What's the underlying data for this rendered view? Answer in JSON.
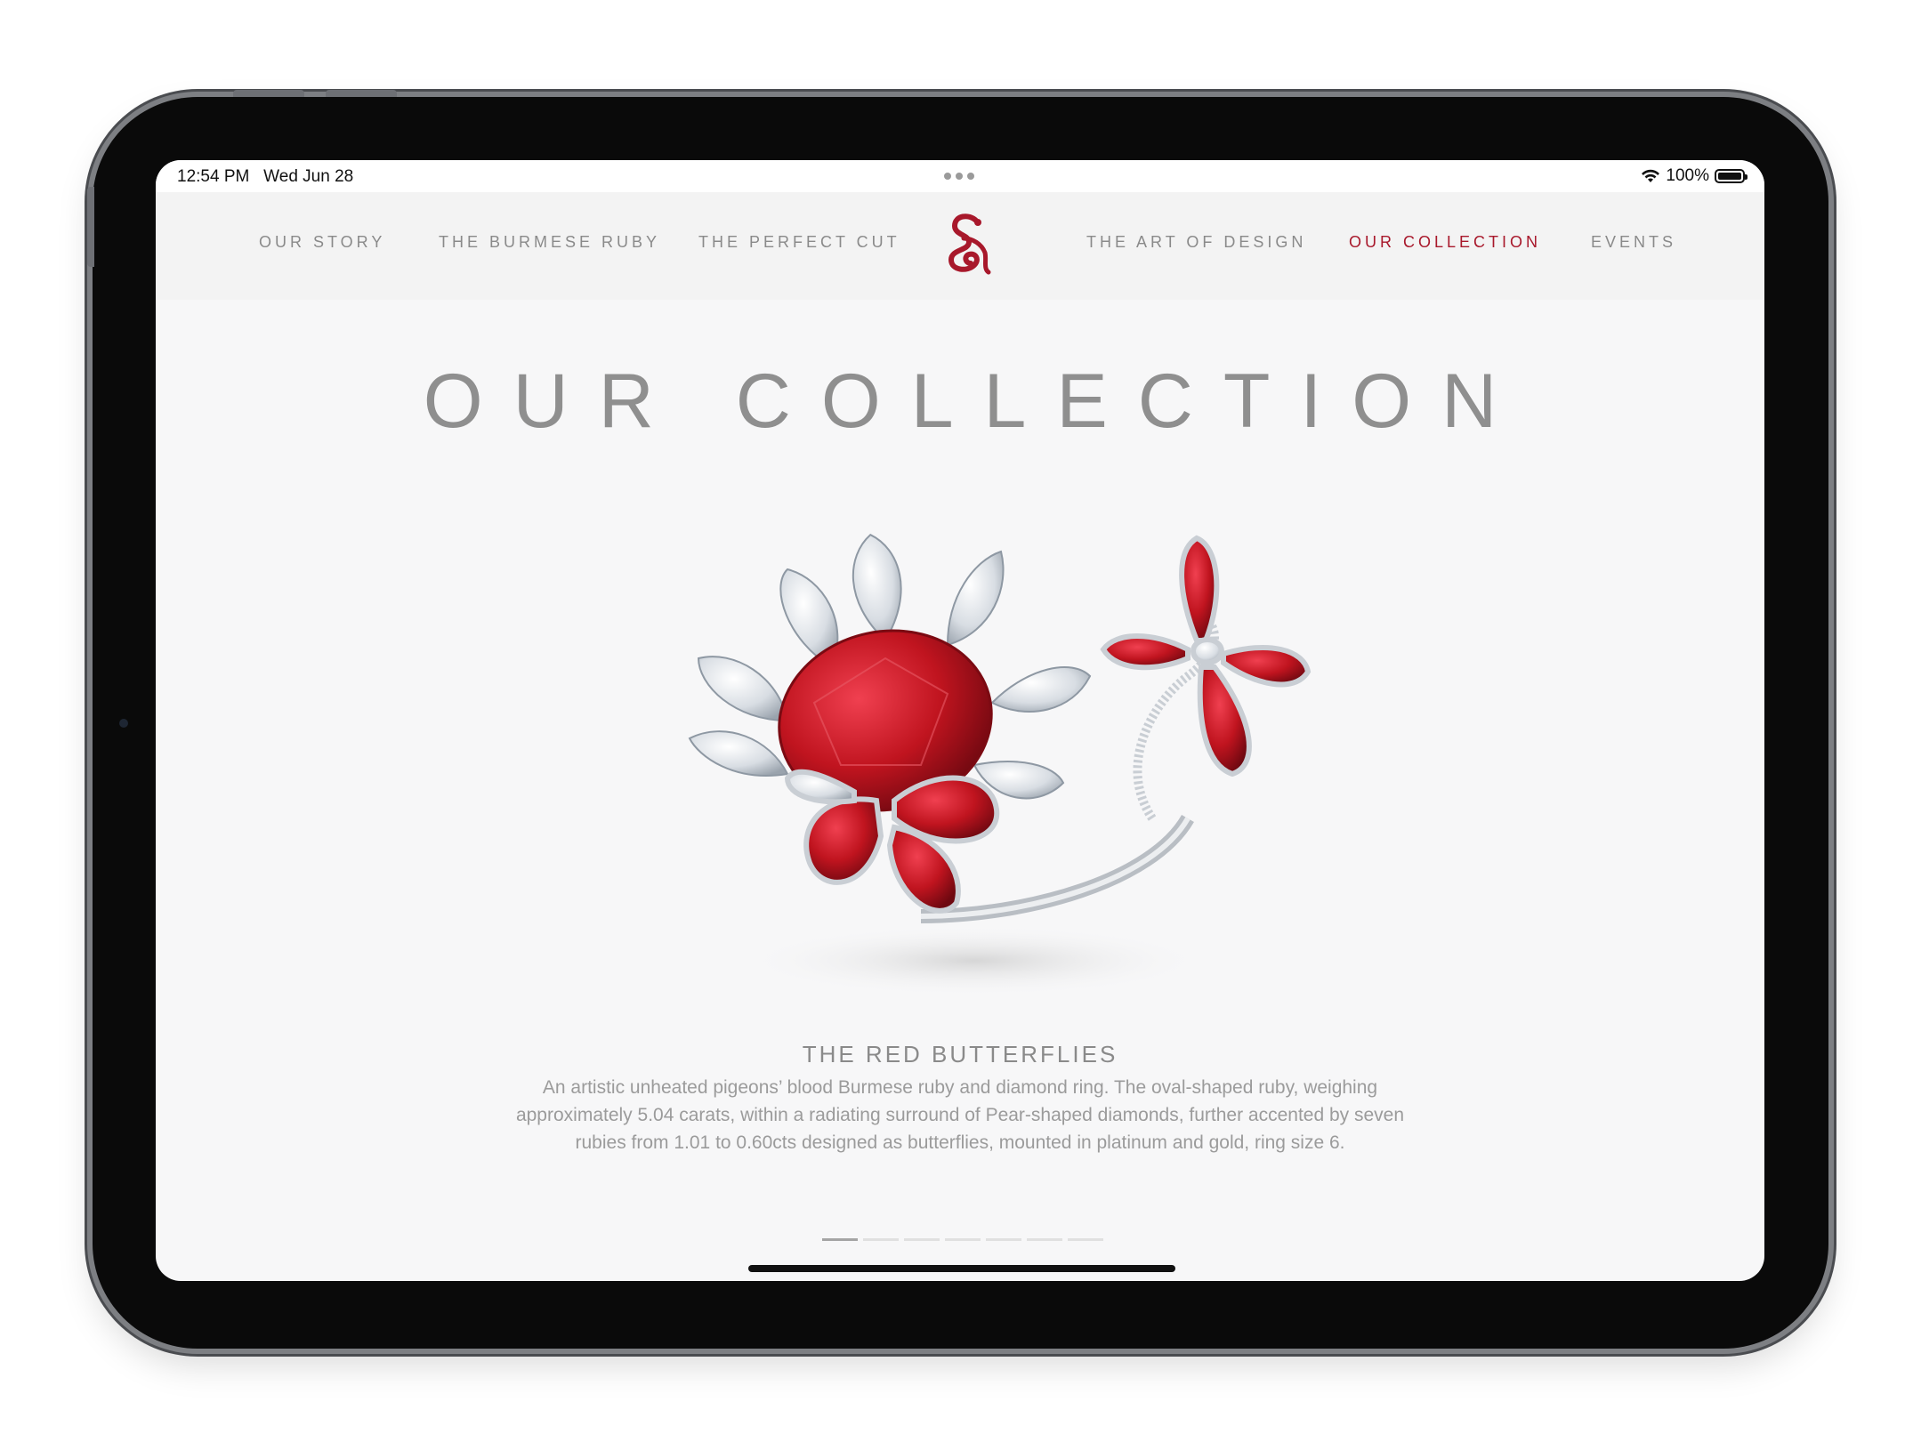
{
  "status": {
    "time": "12:54 PM",
    "date": "Wed Jun 28",
    "battery": "100%",
    "wifi_icon": "wifi-icon",
    "battery_icon": "battery-icon"
  },
  "nav": {
    "items": [
      {
        "label": "OUR STORY"
      },
      {
        "label": "THE BURMESE RUBY"
      },
      {
        "label": "THE PERFECT CUT"
      },
      {
        "label": "THE ART OF DESIGN"
      },
      {
        "label": "OUR COLLECTION"
      },
      {
        "label": "EVENTS"
      }
    ],
    "active": "OUR COLLECTION",
    "logo_icon": "brand-monogram-icon"
  },
  "page": {
    "title": "OUR COLLECTION"
  },
  "product": {
    "name": "THE RED BUTTERFLIES",
    "description": "An artistic unheated pigeons’ blood Burmese ruby and diamond ring. The oval-shaped ruby, weighing approximately 5.04 carats, within a radiating surround of Pear-shaped diamonds, further accented by seven rubies from 1.01 to 0.60cts designed as butterflies, mounted in platinum and gold, ring size 6."
  },
  "pager": {
    "total": 7,
    "current": 1
  },
  "colors": {
    "accent": "#a8182b",
    "nav_text": "#8a8a8a",
    "title_text": "#8f8f8f",
    "ruby": "#c0141f"
  }
}
